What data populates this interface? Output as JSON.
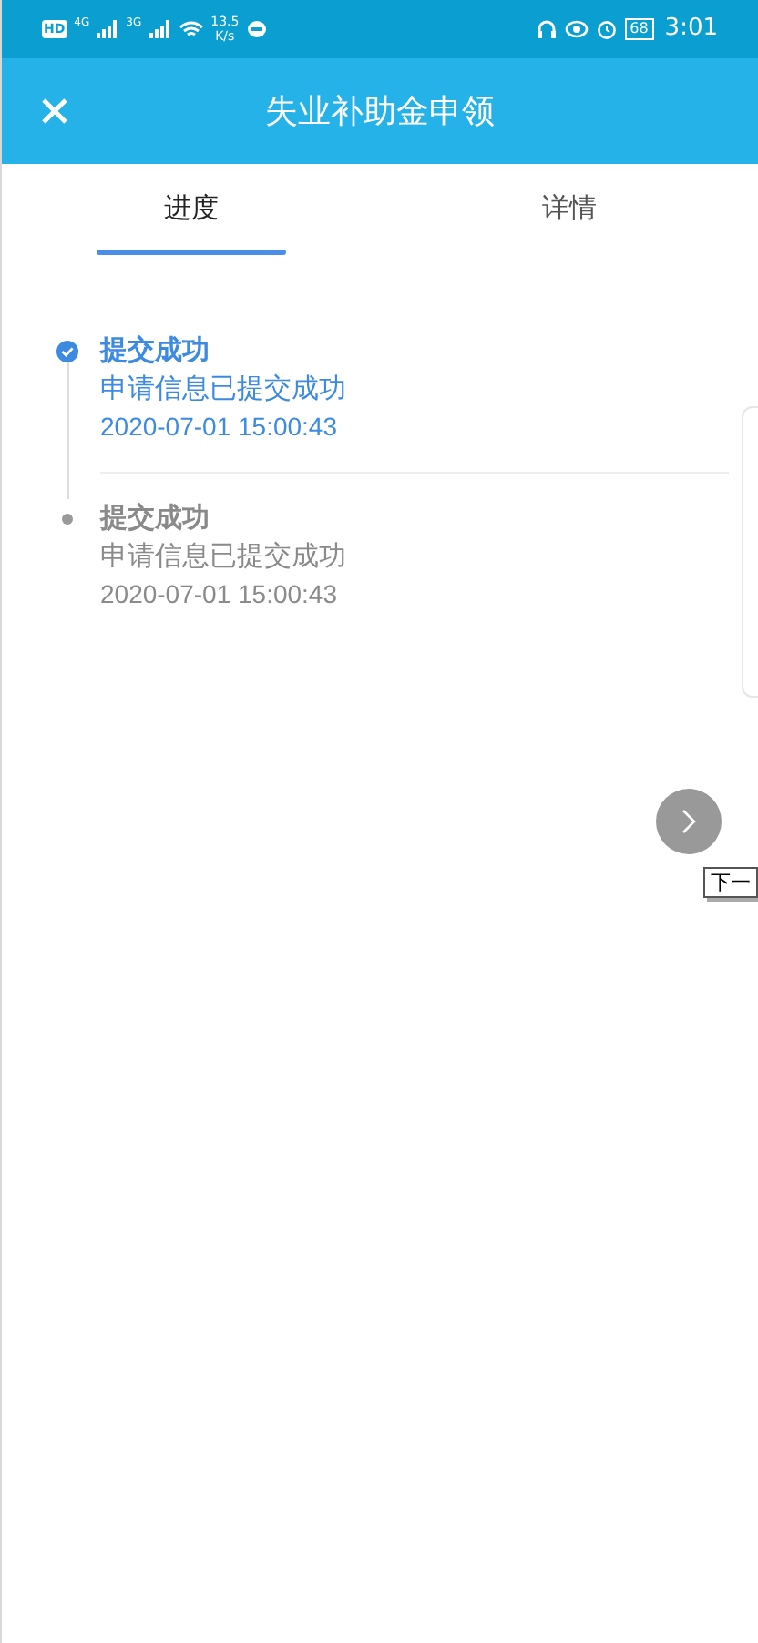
{
  "status_bar": {
    "hd": "HD",
    "network_1": "4G",
    "network_2": "3G",
    "speed": "13.5",
    "speed_unit": "K/s",
    "battery": "68",
    "time": "3:01"
  },
  "header": {
    "title": "失业补助金申领"
  },
  "tabs": [
    {
      "label": "进度",
      "selected": true
    },
    {
      "label": "详情",
      "selected": false
    }
  ],
  "timeline": [
    {
      "title": "提交成功",
      "description": "申请信息已提交成功",
      "time": "2020-07-01 15:00:43",
      "active": true
    },
    {
      "title": "提交成功",
      "description": "申请信息已提交成功",
      "time": "2020-07-01 15:00:43",
      "active": false
    }
  ],
  "next_button": {
    "tooltip": "下一"
  }
}
